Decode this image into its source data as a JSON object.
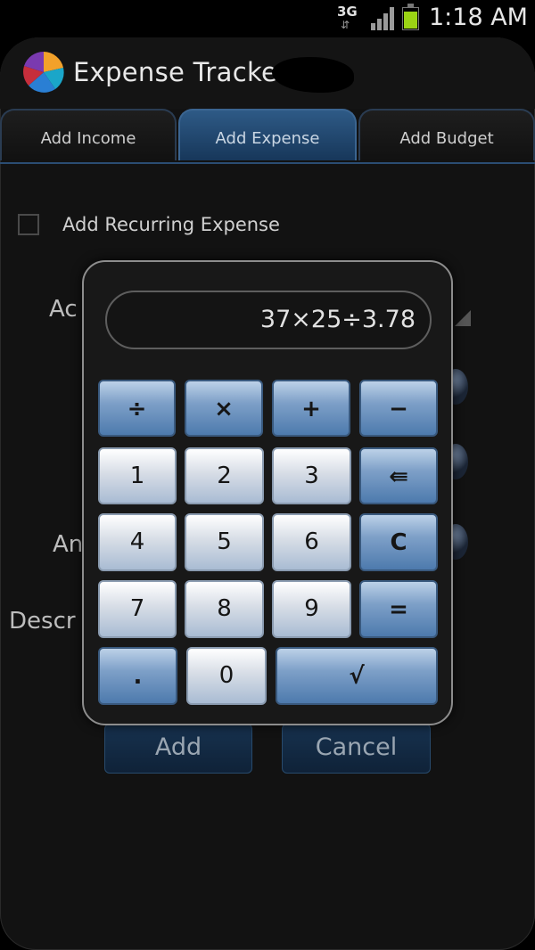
{
  "status_bar": {
    "network": "3G",
    "network_arrows": "⇵",
    "time": "1:18 AM",
    "battery_level": 0.85
  },
  "app": {
    "title": "Expense Tracker"
  },
  "tabs": [
    {
      "label": "Add Income",
      "active": false
    },
    {
      "label": "Add Expense",
      "active": true
    },
    {
      "label": "Add Budget",
      "active": false
    }
  ],
  "form": {
    "recurring_label": "Add Recurring Expense",
    "recurring_checked": false,
    "account_label_partial": "Ac",
    "amount_label_partial": "An",
    "description_label_partial": "Descr",
    "add_button": "Add",
    "cancel_button": "Cancel"
  },
  "calculator": {
    "display": "37×25÷3.78",
    "keys": {
      "divide": "÷",
      "multiply": "×",
      "plus": "+",
      "minus": "−",
      "one": "1",
      "two": "2",
      "three": "3",
      "backspace": "⇚",
      "four": "4",
      "five": "5",
      "six": "6",
      "clear": "C",
      "seven": "7",
      "eight": "8",
      "nine": "9",
      "equals": "=",
      "dot": ".",
      "zero": "0",
      "accept": "√"
    }
  },
  "colors": {
    "accent": "#2e5a86",
    "key_operator": "#4d7aad",
    "key_number": "#d7dde6"
  }
}
